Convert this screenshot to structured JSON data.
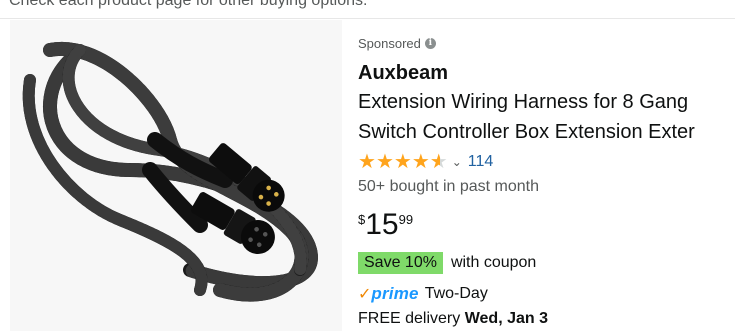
{
  "header": {
    "note": "Check each product page for other buying options."
  },
  "product": {
    "sponsored_label": "Sponsored",
    "brand": "Auxbeam",
    "title_line1": "Extension Wiring Harness for 8 Gang",
    "title_line2": "Switch Controller Box Extension Exter",
    "rating": 4.5,
    "rating_count": "114",
    "bought": "50+ bought in past month",
    "price": {
      "symbol": "$",
      "whole": "15",
      "fraction": "99"
    },
    "coupon": {
      "badge": "Save 10%",
      "text": "with coupon"
    },
    "prime": {
      "check": "✓",
      "word": "prime",
      "text": "Two-Day"
    },
    "delivery": {
      "prefix": "FREE delivery",
      "date": "Wed, Jan 3"
    }
  },
  "colors": {
    "star": "#ffa41c",
    "link": "#2162a1",
    "coupon_bg": "#7fda69",
    "prime_blue": "#1a98ff",
    "prime_orange": "#f08804"
  },
  "icons": [
    "info-icon",
    "star-icon",
    "chevron-down-icon",
    "prime-check-icon"
  ]
}
